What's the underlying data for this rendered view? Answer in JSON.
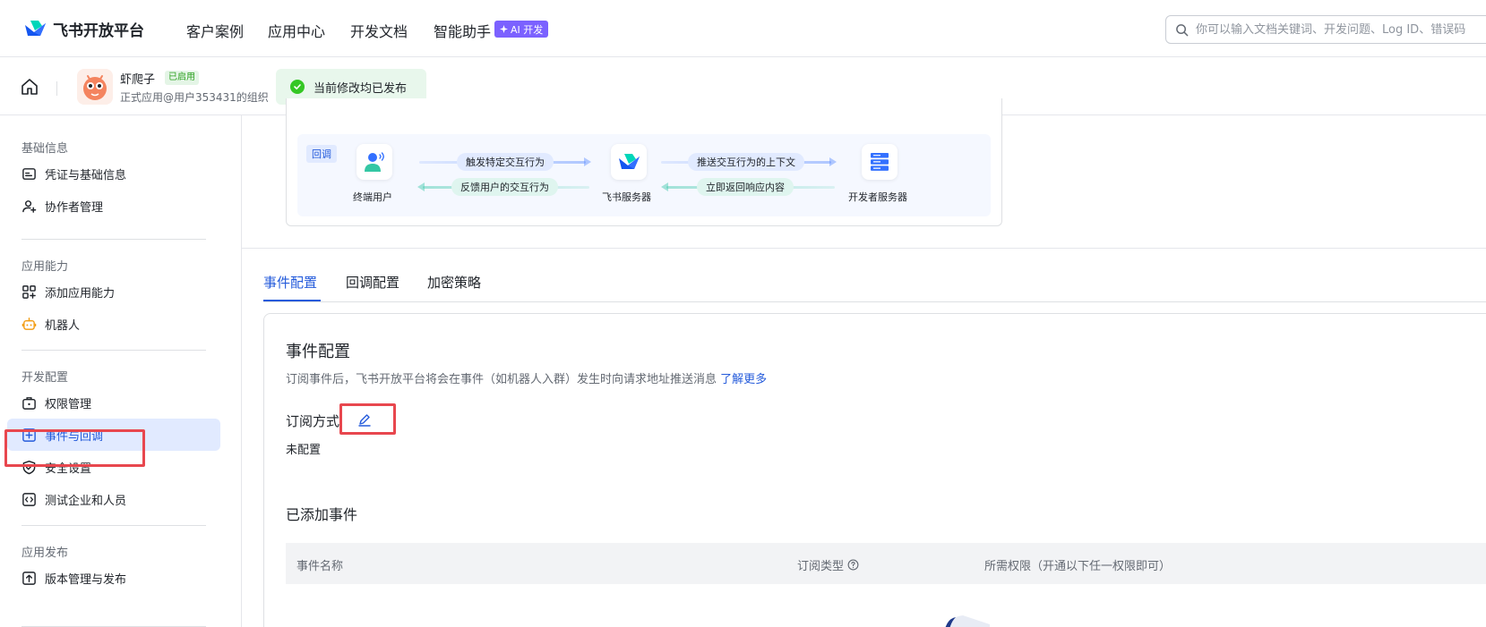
{
  "brand": {
    "name": "飞书开放平台"
  },
  "nav": {
    "links": [
      "客户案例",
      "应用中心",
      "开发文档",
      "智能助手"
    ],
    "ai_badge": "AI 开发"
  },
  "search": {
    "placeholder": "你可以输入文档关键词、开发问题、Log ID、错误码"
  },
  "app": {
    "name": "虾爬子",
    "status": "已启用",
    "org": "正式应用@用户353431的组织"
  },
  "publish_banner": "当前修改均已发布",
  "sidebar": {
    "groups": [
      {
        "title": "基础信息",
        "items": [
          "凭证与基础信息",
          "协作者管理"
        ]
      },
      {
        "title": "应用能力",
        "items": [
          "添加应用能力",
          "机器人"
        ]
      },
      {
        "title": "开发配置",
        "items": [
          "权限管理",
          "事件与回调",
          "安全设置",
          "测试企业和人员"
        ]
      },
      {
        "title": "应用发布",
        "items": [
          "版本管理与发布"
        ]
      }
    ],
    "active_item": "事件与回调"
  },
  "diagram": {
    "tag": "回调",
    "nodes": [
      "终端用户",
      "飞书服务器",
      "开发者服务器"
    ],
    "flows": [
      "触发特定交互行为",
      "反馈用户的交互行为",
      "推送交互行为的上下文",
      "立即返回响应内容"
    ]
  },
  "tabs": [
    "事件配置",
    "回调配置",
    "加密策略"
  ],
  "event_config": {
    "title": "事件配置",
    "description": "订阅事件后，飞书开放平台将会在事件（如机器人入群）发生时向请求地址推送消息",
    "learn_more": "了解更多",
    "subscription_label": "订阅方式",
    "subscription_value": "未配置",
    "added_title": "已添加事件",
    "table_headers": [
      "事件名称",
      "订阅类型",
      "所需权限（开通以下任一权限即可）"
    ]
  },
  "colors": {
    "accent": "#245bdb",
    "active_bg": "#e1eaff",
    "success": "#34c724",
    "highlight": "#e8474e"
  }
}
